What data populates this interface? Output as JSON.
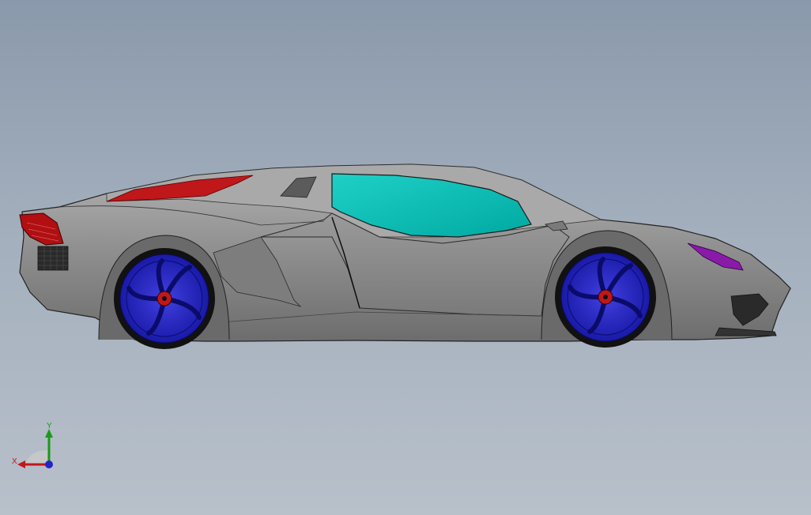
{
  "viewport": {
    "background_top": "#8a99ab",
    "background_bottom": "#b8c0ca"
  },
  "model": {
    "body_color": "#8f8f8f",
    "glass_color": "#00b8b0",
    "taillight_color": "#b10f12",
    "engine_cover_color": "#c0171a",
    "headlight_color": "#8a1aa8",
    "wheel_color": "#2323c8",
    "hub_color": "#c0171a",
    "tire_color": "#111111"
  },
  "triad": {
    "x_label": "X",
    "y_label": "Y",
    "x_color": "#c0171a",
    "y_color": "#1a9a1a",
    "z_color": "#2323c8"
  }
}
